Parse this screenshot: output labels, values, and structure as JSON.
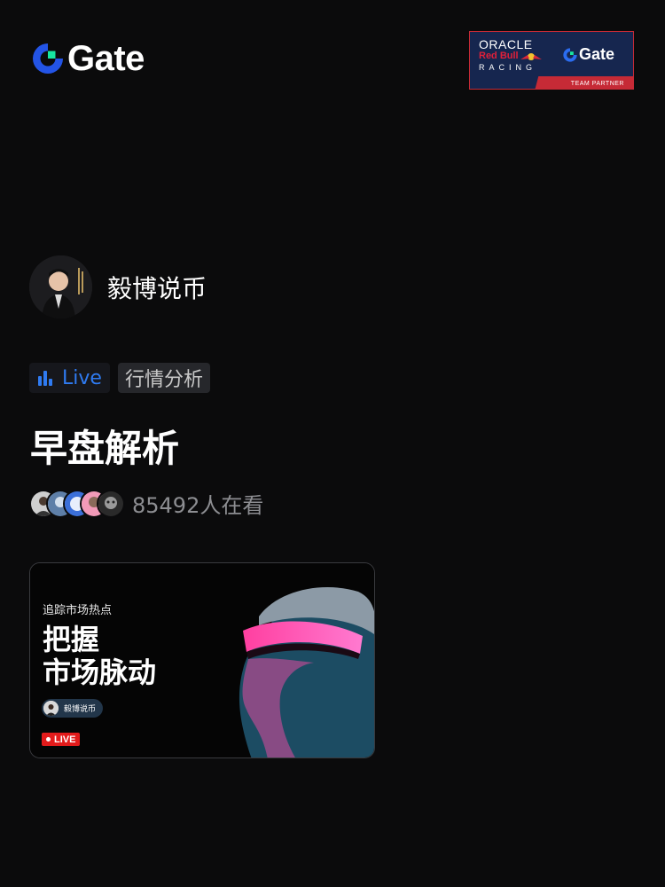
{
  "header": {
    "logo_text": "Gate",
    "logo_icon": "gate-logo-icon",
    "partner": {
      "oracle": "ORACLE",
      "redbull": "Red Bull",
      "racing": "RACING",
      "gate_text": "Gate",
      "badge": "TEAM PARTNER"
    }
  },
  "host": {
    "name": "毅博说币",
    "avatar_icon": "host-avatar"
  },
  "tags": {
    "live_label": "Live",
    "live_icon": "bar-chart-icon",
    "category": "行情分析"
  },
  "stream": {
    "title": "早盘解析",
    "viewers": "85492人在看"
  },
  "card": {
    "subtitle": "追踪市场热点",
    "headline_1": "把握",
    "headline_2": "市场脉动",
    "chip_name": "毅博说币",
    "live_badge": "LIVE"
  },
  "colors": {
    "background": "#0b0b0c",
    "accent_blue": "#2f7bf2",
    "gate_green": "#17e6a1",
    "live_red": "#e21b1b"
  }
}
